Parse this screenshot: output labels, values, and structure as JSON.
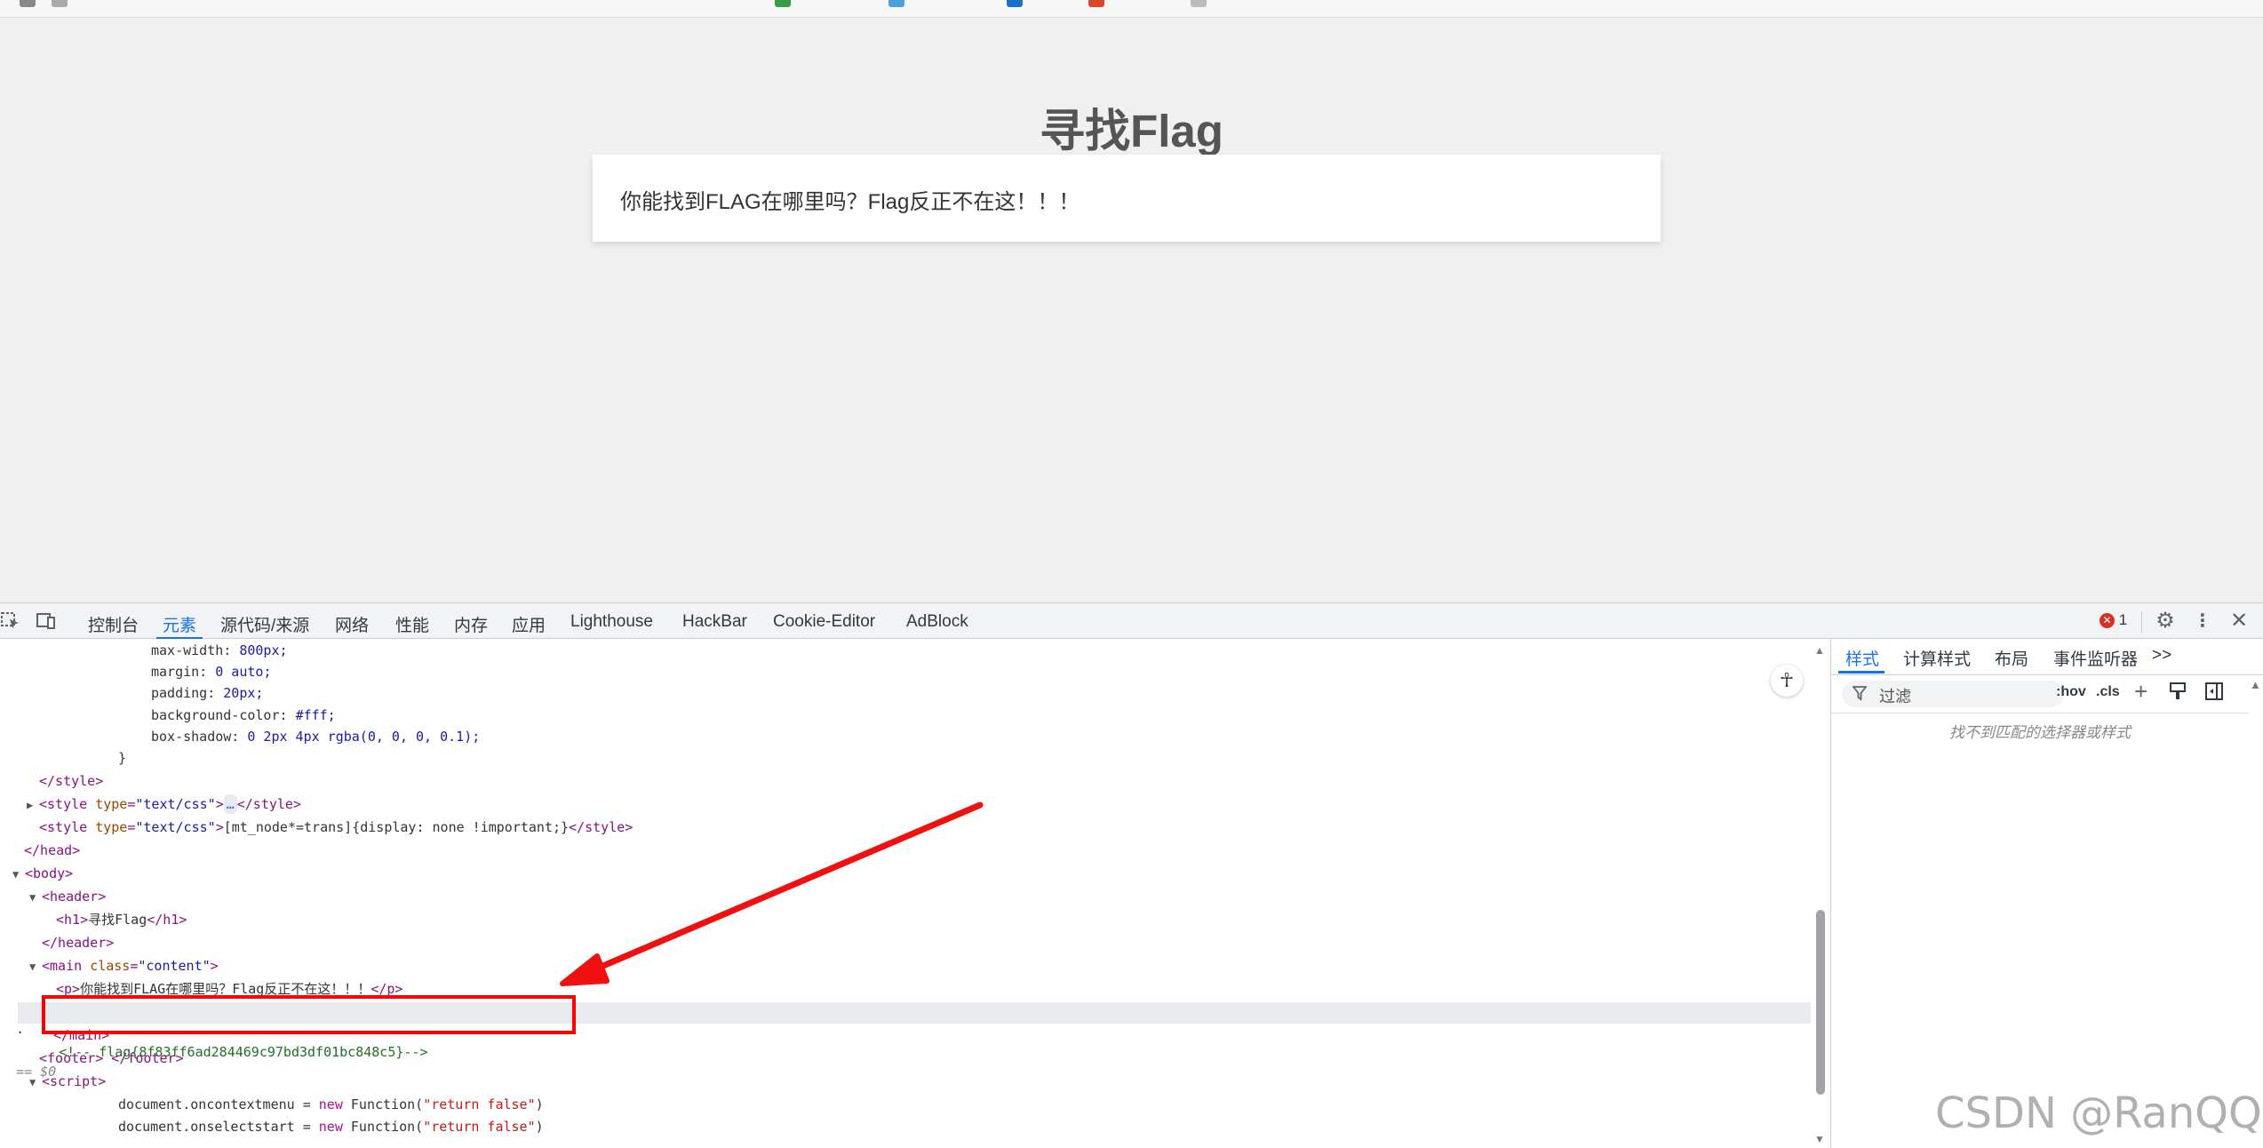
{
  "page": {
    "heading": "寻找Flag",
    "paragraph": "你能找到FLAG在哪里吗？Flag反正不在这！！！"
  },
  "devtools": {
    "tabs": [
      "控制台",
      "元素",
      "源代码/来源",
      "网络",
      "性能",
      "内存",
      "应用",
      "Lighthouse",
      "HackBar",
      "Cookie-Editor",
      "AdBlock"
    ],
    "active_tab": "元素",
    "error_count": "1",
    "styles_pane": {
      "tabs": [
        "样式",
        "计算样式",
        "布局",
        "事件监听器"
      ],
      "more": ">>",
      "filter_placeholder": "过滤",
      "hov": ":hov",
      "cls": ".cls",
      "empty_message": "找不到匹配的选择器或样式"
    },
    "dom_lines": {
      "l1": "max-width: ",
      "l1v": "800px;",
      "l2": "margin: ",
      "l2v": "0 auto;",
      "l3": "padding: ",
      "l3v": "20px;",
      "l4": "background-color: ",
      "l4v": "#fff;",
      "l5": "box-shadow: ",
      "l5v": "0 2px 4px rgba(0, 0, 0, 0.1);",
      "l6": "}",
      "style_close": "</style>",
      "style_collapsed_open": "<style ",
      "type_attr": "type",
      "type_val": "\"text/css\"",
      "ellipsis": "…",
      "style_close2": "</style>",
      "style2_content": "[mt_node*=trans]{display: none !important;}",
      "head_close": "</head>",
      "body_open": "<body>",
      "header_open": "<header>",
      "h1_text": "寻找Flag",
      "header_close": "</header>",
      "main_open": "<main ",
      "class_attr": "class",
      "class_val": "\"content\"",
      "p_text": "你能找到FLAG在哪里吗？Flag反正不在这！！！",
      "comment": "<!-- flag{8f83ff6ad284469c97bd3df01bc848c5}-->",
      "selected_marker": "== $0",
      "main_close": "</main>",
      "footer": "<footer> </footer>",
      "script_open": "<script>",
      "js1_a": "document.oncontextmenu = ",
      "js1_kw": "new",
      "js1_b": " Function(",
      "js1_s": "\"return false\"",
      "js1_c": ")",
      "js2_a": "document.onselectstart = "
    }
  },
  "watermark": "CSDN @RanQQQ",
  "colors": {
    "page_bg": "#f0f0f0",
    "accent": "#1a73e8",
    "highlight_box": "#ff0000",
    "error": "#d93025"
  }
}
